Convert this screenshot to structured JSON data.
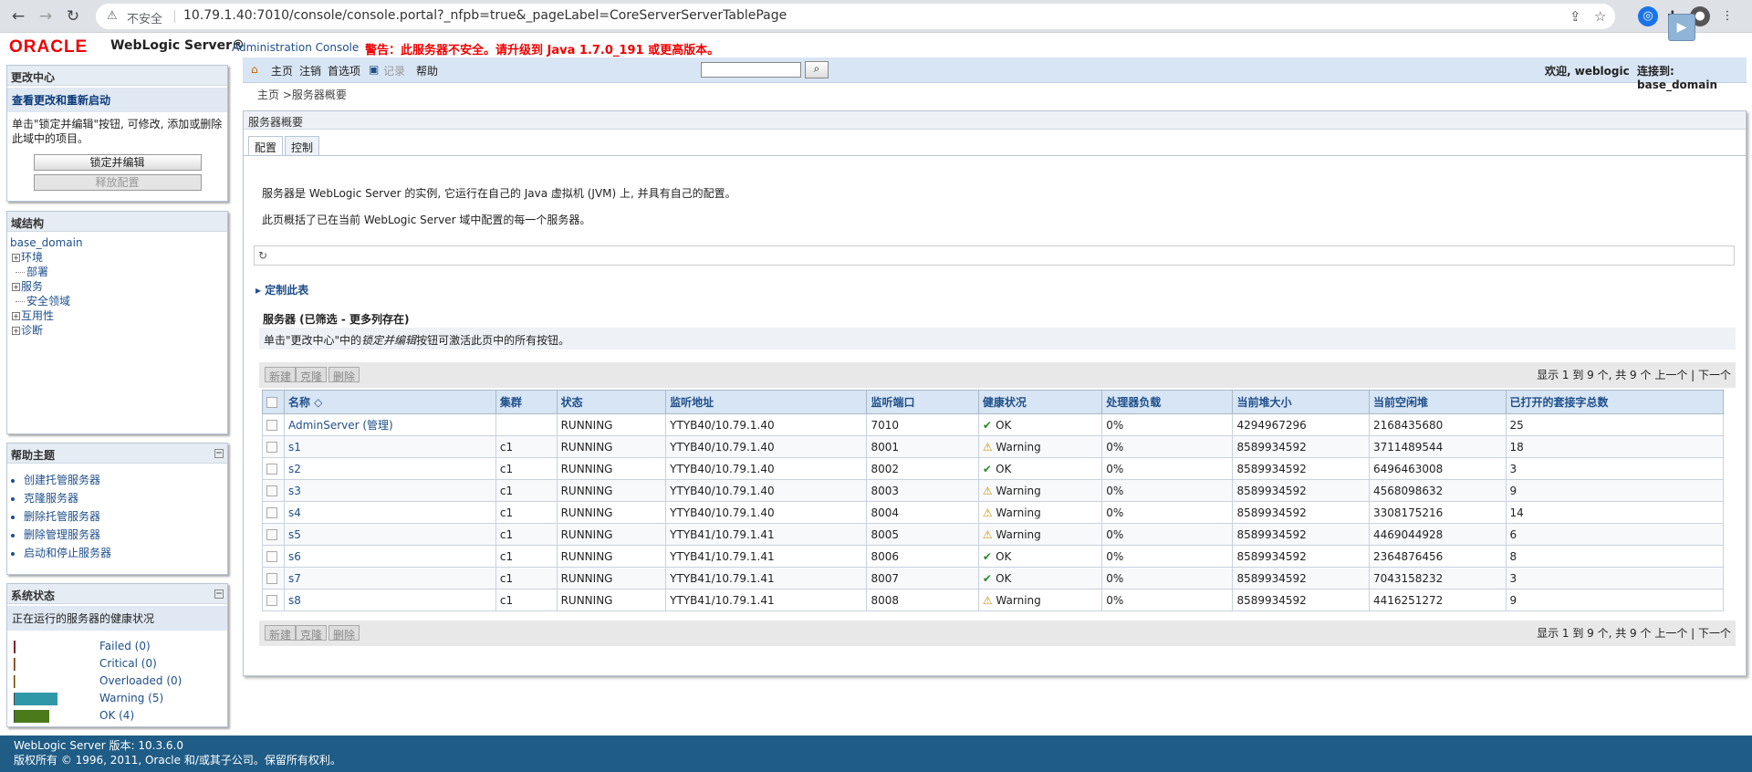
{
  "browser": {
    "insecure": "不安全",
    "url": "10.79.1.40:7010/console/console.portal?_nfpb=true&_pageLabel=CoreServerServerTablePage"
  },
  "header": {
    "logo": "ORACLE",
    "product": "WebLogic Server®",
    "console": "Administration Console",
    "warning": "警告：此服务器不安全。请升级到 Java 1.7.0_191 或更高版本。"
  },
  "change_center": {
    "title": "更改中心",
    "subtitle": "查看更改和重新启动",
    "desc": "单击\"锁定并编辑\"按钮, 可修改, 添加或删除此域中的项目。",
    "lock_btn": "锁定并编辑",
    "release_btn": "释放配置"
  },
  "domain_tree": {
    "title": "域结构",
    "root": "base_domain",
    "items": [
      "环境",
      "部署",
      "服务",
      "安全领域",
      "互用性",
      "诊断"
    ]
  },
  "help": {
    "title": "帮助主题",
    "items": [
      "创建托管服务器",
      "克隆服务器",
      "删除托管服务器",
      "删除管理服务器",
      "启动和停止服务器"
    ]
  },
  "system_status": {
    "title": "系统状态",
    "subtitle": "正在运行的服务器的健康状况",
    "rows": [
      {
        "label": "Failed (0)",
        "frac": 0,
        "color": "#cc0000"
      },
      {
        "label": "Critical (0)",
        "frac": 0,
        "color": "#ff6600"
      },
      {
        "label": "Overloaded (0)",
        "frac": 0,
        "color": "#e8a000"
      },
      {
        "label": "Warning (5)",
        "frac": 0.556,
        "color": "#2f98a8"
      },
      {
        "label": "OK (4)",
        "frac": 0.444,
        "color": "#4a7a1a"
      }
    ]
  },
  "toolbar": {
    "home": "主页",
    "logout": "注销",
    "prefs": "首选项",
    "record": "记录",
    "help": "帮助",
    "welcome": "欢迎, weblogic",
    "connected": "连接到: base_domain"
  },
  "breadcrumb": "主页 >服务器概要",
  "main": {
    "title": "服务器概要",
    "tabs": [
      "配置",
      "控制"
    ],
    "p1": "服务器是 WebLogic Server 的实例, 它运行在自己的 Java 虚拟机 (JVM) 上, 并具有自己的配置。",
    "p2": "此页概括了已在当前 WebLogic Server 域中配置的每一个服务器。",
    "customize": "定制此表",
    "table_title": "服务器 (已筛选 - 更多列存在)",
    "note_a": "单击\"更改中心\"中的",
    "note_i": "锁定并编辑",
    "note_b": "按钮可激活此页中的所有按钮。",
    "btn_new": "新建",
    "btn_clone": "克隆",
    "btn_delete": "删除",
    "pager": "显示 1 到 9 个, 共 9 个  上一个 | 下一个",
    "columns": [
      "名称 ◇",
      "集群",
      "状态",
      "监听地址",
      "监听端口",
      "健康状况",
      "处理器负载",
      "当前堆大小",
      "当前空闲堆",
      "已打开的套接字总数"
    ],
    "rows": [
      [
        "AdminServer (管理)",
        "",
        "RUNNING",
        "YTYB40/10.79.1.40",
        "7010",
        "OK",
        "0%",
        "4294967296",
        "2168435680",
        "25"
      ],
      [
        "s1",
        "c1",
        "RUNNING",
        "YTYB40/10.79.1.40",
        "8001",
        "Warning",
        "0%",
        "8589934592",
        "3711489544",
        "18"
      ],
      [
        "s2",
        "c1",
        "RUNNING",
        "YTYB40/10.79.1.40",
        "8002",
        "OK",
        "0%",
        "8589934592",
        "6496463008",
        "3"
      ],
      [
        "s3",
        "c1",
        "RUNNING",
        "YTYB40/10.79.1.40",
        "8003",
        "Warning",
        "0%",
        "8589934592",
        "4568098632",
        "9"
      ],
      [
        "s4",
        "c1",
        "RUNNING",
        "YTYB40/10.79.1.40",
        "8004",
        "Warning",
        "0%",
        "8589934592",
        "3308175216",
        "14"
      ],
      [
        "s5",
        "c1",
        "RUNNING",
        "YTYB41/10.79.1.41",
        "8005",
        "Warning",
        "0%",
        "8589934592",
        "4469044928",
        "6"
      ],
      [
        "s6",
        "c1",
        "RUNNING",
        "YTYB41/10.79.1.41",
        "8006",
        "OK",
        "0%",
        "8589934592",
        "2364876456",
        "8"
      ],
      [
        "s7",
        "c1",
        "RUNNING",
        "YTYB41/10.79.1.41",
        "8007",
        "OK",
        "0%",
        "8589934592",
        "7043158232",
        "3"
      ],
      [
        "s8",
        "c1",
        "RUNNING",
        "YTYB41/10.79.1.41",
        "8008",
        "Warning",
        "0%",
        "8589934592",
        "4416251272",
        "9"
      ]
    ]
  },
  "footer": {
    "version": "WebLogic Server 版本: 10.3.6.0",
    "copyright": "版权所有 © 1996, 2011, Oracle 和/或其子公司。保留所有权利。"
  }
}
